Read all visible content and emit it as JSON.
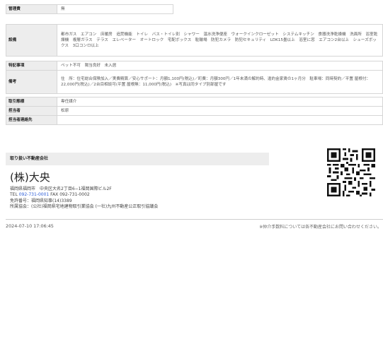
{
  "spec_rows": [
    {
      "label": "管理費",
      "value": "無"
    },
    {
      "label": "設備",
      "value": "都市ガス　エアコン　床暖房　追焚機能　トイレ　バス・トイレ別　シャワー　温水洗浄便座　ウォークインクローゼット　システムキッチン　食器洗浄乾燥機　洗面所　浴室乾燥機　複層ガラス　テラス　エレベーター　オートロック　宅配ボックス　駐輪場　防犯カメラ　防犯セキュリティ　LDK15畳以上　浴室に窓　エアコン2台以上　シューズボックス　3口コンロ以上"
    },
    {
      "label": "特記事項",
      "value": "ペット不可　陽当良好　未入居"
    },
    {
      "label": "備考",
      "value": "住　所：住宅総合保険加入／実費精算／安心サポート：月額1,100円(税込)／町費：月額300円／1年未満の解約時、違約金家賃の1ヶ月分　駐車場：同時契約／平置 屋根付：22,000円(税込)／2台目相談可(平置 屋根無：11,000円(税込)　※写真は同タイプ別部屋です"
    },
    {
      "label": "取引態様",
      "value": "専任媒介"
    },
    {
      "label": "担当者",
      "value": "松原"
    },
    {
      "label": "担当者連絡先",
      "value": ""
    }
  ],
  "agency": {
    "header": "取り扱い不動産会社",
    "name": "(株)大央",
    "address": "福岡県福岡市　中央区大名2丁目6−1福岡国際ビル2F",
    "tel_label": "TEL",
    "tel": "092-731-0001",
    "fax": "FAX 092-731-0002",
    "license": "免許番号：福岡県知事(14)3389",
    "association": "所属協会：(公社)福岡県宅地建物取引業協会 (一社)九州不動産公正取引協議会"
  },
  "footer": {
    "date": "2024-07-10 17:06:45",
    "note": "※仲介手数料については各不動産会社にお問い合わせください。"
  },
  "colors": {
    "header_bg": "#ededed",
    "tel_link": "#2a5bd7"
  }
}
